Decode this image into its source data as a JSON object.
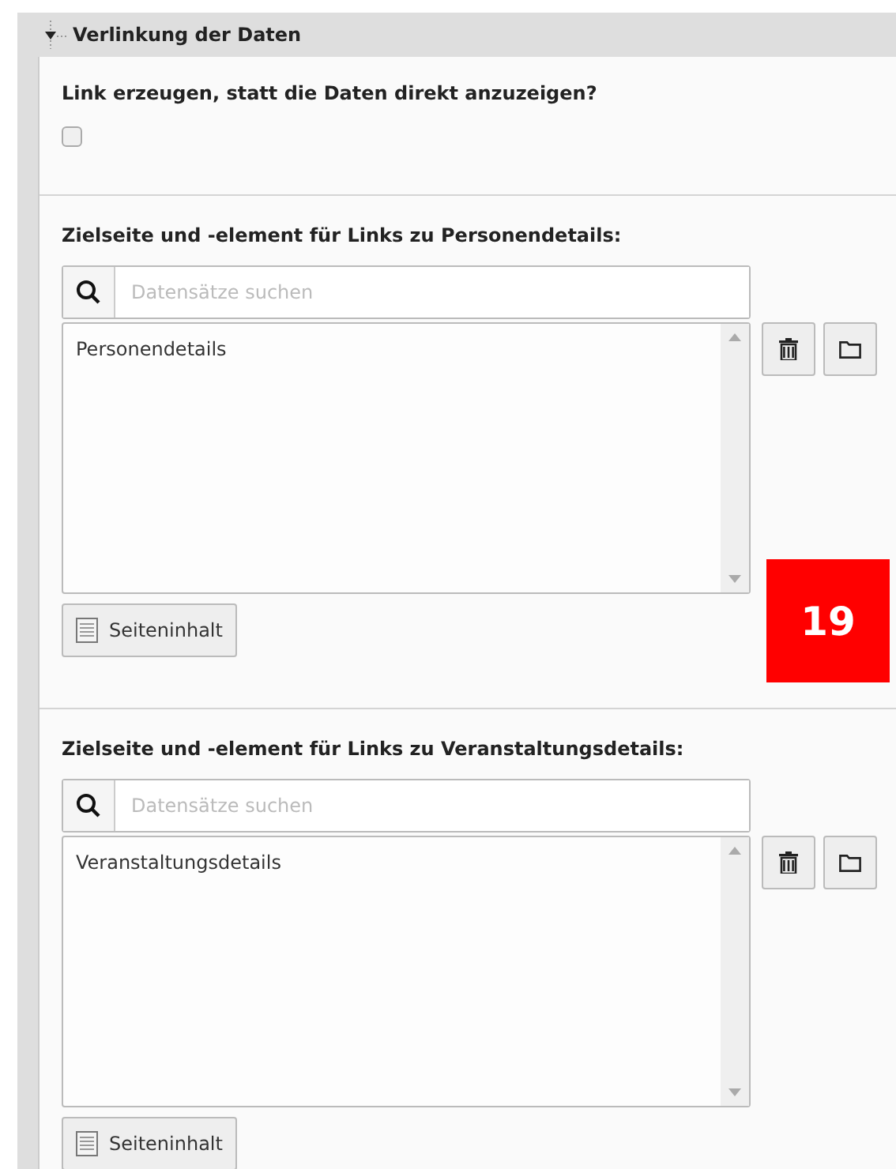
{
  "section": {
    "title": "Verlinkung der Daten",
    "expanded": true
  },
  "fields": [
    {
      "kind": "checkbox",
      "label": "Link erzeugen, statt die Daten direkt anzuzeigen?",
      "checked": false
    },
    {
      "kind": "relation",
      "label": "Zielseite und -element für Links zu Personendetails:",
      "search_placeholder": "Datensätze suchen",
      "items": [
        "Personendetails"
      ],
      "add_button": "Seiteninhalt",
      "badge": "19"
    },
    {
      "kind": "relation",
      "label": "Zielseite und -element für Links zu Veranstaltungsdetails:",
      "search_placeholder": "Datensätze suchen",
      "items": [
        "Veranstaltungsdetails"
      ],
      "add_button": "Seiteninhalt"
    }
  ]
}
